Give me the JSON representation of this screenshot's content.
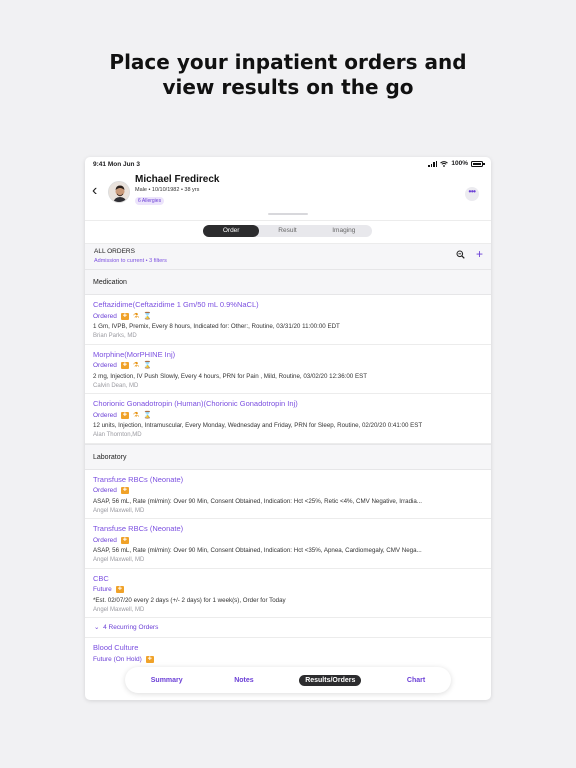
{
  "headline": {
    "line1": "Place your inpatient orders and",
    "line2": "view results on the go"
  },
  "statusbar": {
    "time": "9:41  Mon Jun 3",
    "battery": "100%"
  },
  "patient": {
    "name": "Michael Fredireck",
    "demographics": "Male • 10/10/1982 • 38 yrs",
    "allergies": "6 Allergies"
  },
  "segments": [
    {
      "label": "Order",
      "active": true
    },
    {
      "label": "Result",
      "active": false
    },
    {
      "label": "Imaging",
      "active": false
    }
  ],
  "all_orders": {
    "title": "ALL ORDERS",
    "subtitle": "Admission to current  • 3 filters"
  },
  "medication": {
    "heading": "Medication",
    "orders": [
      {
        "name": "Ceftazidime(Ceftazidime 1 Gm/50 mL 0.9%NaCL)",
        "status": "Ordered",
        "detail": "1 Gm, IVPB, Premix, Every 8 hours, Indicated for: Other:, Routine, 03/31/20 11:00:00 EDT",
        "doctor": "Brian Parks, MD"
      },
      {
        "name": "Morphine(MorPHINE Inj)",
        "status": "Ordered",
        "detail": "2 mg, Injection, IV Push Slowly, Every 4 hours, PRN for Pain , Mild, Routine, 03/02/20 12:36:00 EST",
        "doctor": "Calvin Dean, MD"
      },
      {
        "name": "Chorionic Gonadotropin (Human)(Chorionic Gonadotropin Inj)",
        "status": "Ordered",
        "detail": "12 units, Injection, Intramuscular, Every Monday, Wednesday and Friday, PRN for Sleep, Routine, 02/20/20 0:41:00 EST",
        "doctor": "Alan Thornton,MD"
      }
    ]
  },
  "laboratory": {
    "heading": "Laboratory",
    "orders": [
      {
        "name": "Transfuse RBCs (Neonate)",
        "status": "Ordered",
        "detail": "ASAP, 56 mL, Rate (ml/min): Over 90 Min, Consent Obtained, Indication: Hct <25%, Retic <4%, CMV Negative, Irradia...",
        "doctor": "Angel Maxwell, MD"
      },
      {
        "name": "Transfuse RBCs (Neonate)",
        "status": "Ordered",
        "detail": "ASAP, 56 mL, Rate (ml/min): Over 90 Min, Consent Obtained, Indication: Hct <35%, Apnea, Cardiomegaly, CMV Nega...",
        "doctor": "Angel Maxwell, MD"
      },
      {
        "name": "CBC",
        "status": "Future",
        "detail": "*Est. 02/07/20 every 2 days (+/- 2 days) for 1 week(s), Order for Today",
        "doctor": "Angel Maxwell, MD"
      }
    ],
    "recurring": "4 Recurring Orders",
    "last": {
      "name": "Blood Culture",
      "status": "Future (On Hold)"
    }
  },
  "tabs": [
    {
      "label": "Summary",
      "active": false
    },
    {
      "label": "Notes",
      "active": false
    },
    {
      "label": "Results/Orders",
      "active": true
    },
    {
      "label": "Chart",
      "active": false
    }
  ],
  "colors": {
    "accent": "#6b3fd6",
    "link": "#7b4fe0",
    "icon": "#f0a229"
  }
}
